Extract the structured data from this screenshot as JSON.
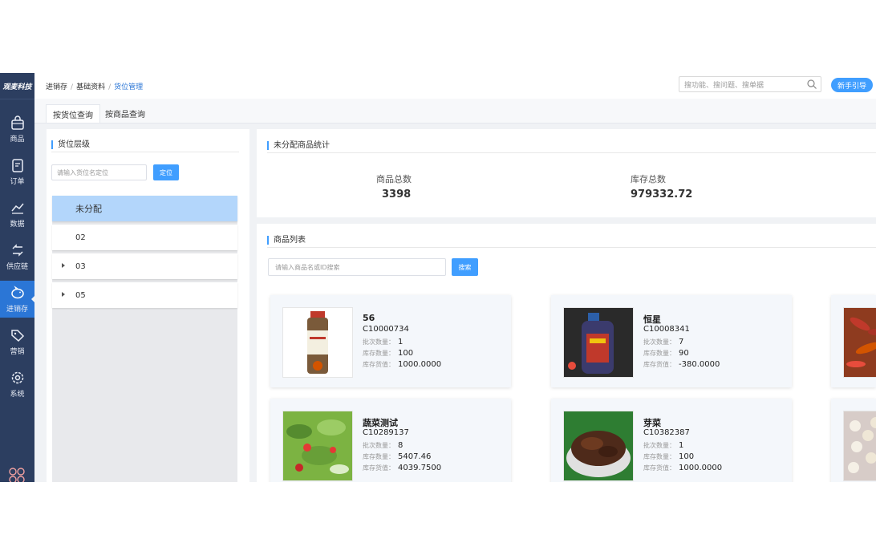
{
  "brand": "观麦科技",
  "nav": [
    {
      "label": "商品",
      "icon": "bag-icon"
    },
    {
      "label": "订单",
      "icon": "document-icon"
    },
    {
      "label": "数据",
      "icon": "chart-icon"
    },
    {
      "label": "供应链",
      "icon": "exchange-icon"
    },
    {
      "label": "进销存",
      "icon": "piggy-bank-icon",
      "active": true
    },
    {
      "label": "营销",
      "icon": "tag-icon"
    },
    {
      "label": "系统",
      "icon": "gear-icon"
    }
  ],
  "breadcrumb": {
    "items": [
      "进销存",
      "基础资料",
      "货位管理"
    ],
    "sep": "/"
  },
  "header": {
    "search_placeholder": "搜功能、搜问题、搜单据",
    "guide_label": "新手引导"
  },
  "tabs": [
    {
      "label": "按货位查询",
      "active": true
    },
    {
      "label": "按商品查询",
      "active": false
    }
  ],
  "location_panel": {
    "title": "货位层级",
    "input_placeholder": "请输入货位名定位",
    "locate_label": "定位",
    "items": [
      {
        "label": "未分配",
        "active": true,
        "expandable": false
      },
      {
        "label": "02",
        "active": false,
        "expandable": false
      },
      {
        "label": "03",
        "active": false,
        "expandable": true
      },
      {
        "label": "05",
        "active": false,
        "expandable": true
      }
    ]
  },
  "stats": {
    "title": "未分配商品统计",
    "total_goods_label": "商品总数",
    "total_goods_value": "3398",
    "total_stock_label": "库存总数",
    "total_stock_value": "979332.72"
  },
  "products": {
    "title": "商品列表",
    "search_placeholder": "请输入商品名或ID搜索",
    "search_label": "搜索",
    "batch_label": "批次数量：",
    "stock_label": "库存数量：",
    "value_label": "库存货值：",
    "items": [
      {
        "name": "56",
        "code": "C10000734",
        "batches": "1",
        "stock": "100",
        "value": "1000.0000",
        "image": "spice-jar"
      },
      {
        "name": "恒星",
        "code": "C10008341",
        "batches": "7",
        "stock": "90",
        "value": "-380.0000",
        "image": "sauce-bottle"
      },
      {
        "name": "",
        "code": "",
        "batches": "",
        "stock": "",
        "value": "",
        "image": "chili-peppers"
      },
      {
        "name": "蔬菜测试",
        "code": "C10289137",
        "batches": "8",
        "stock": "5407.46",
        "value": "4039.7500",
        "image": "vegetable-salad"
      },
      {
        "name": "芽菜",
        "code": "C10382387",
        "batches": "1",
        "stock": "100",
        "value": "1000.0000",
        "image": "pickled-sprouts"
      },
      {
        "name": "",
        "code": "",
        "batches": "",
        "stock": "",
        "value": "",
        "image": "white-beans"
      }
    ]
  },
  "colors": {
    "sidebar": "#2c3e60",
    "accent": "#409eff",
    "active_nav": "#2b76d6",
    "active_tree": "#b3d6fb"
  }
}
